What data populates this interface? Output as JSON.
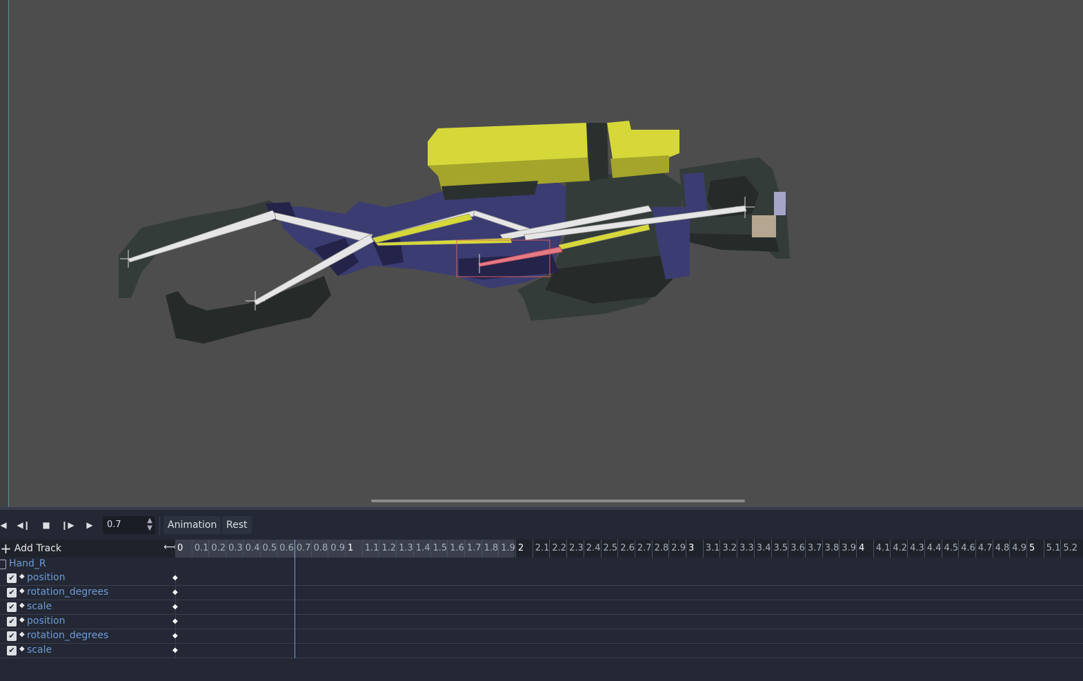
{
  "viewport": {
    "scene_name": "weapon-sprite-with-bone-skeleton"
  },
  "toolbar": {
    "buttons": [
      {
        "name": "play-backwards-from-end",
        "icon": "◀"
      },
      {
        "name": "play-backwards",
        "icon": "◀❙"
      },
      {
        "name": "stop",
        "icon": "■"
      },
      {
        "name": "play-from-start",
        "icon": "❙▶"
      },
      {
        "name": "play",
        "icon": "▶"
      }
    ],
    "time_value": "0.7",
    "spin_icon": "⌃⌄",
    "animation_label": "Animation",
    "rest_label": "Rest"
  },
  "timeline": {
    "add_track_label": "Add Track",
    "add_track_icon": "+",
    "zoom_icon": "⟷",
    "ruler_labels": [
      "0",
      "0.1",
      "0.2",
      "0.3",
      "0.4",
      "0.5",
      "0.6",
      "0.7",
      "0.8",
      "0.9",
      "1",
      "1.1",
      "1.2",
      "1.3",
      "1.4",
      "1.5",
      "1.6",
      "1.7",
      "1.8",
      "1.9",
      "2",
      "2.1",
      "2.2",
      "2.3",
      "2.4",
      "2.5",
      "2.6",
      "2.7",
      "2.8",
      "2.9",
      "3",
      "3.1",
      "3.2",
      "3.3",
      "3.4",
      "3.5",
      "3.6",
      "3.7",
      "3.8",
      "3.9",
      "4",
      "4.1",
      "4.2",
      "4.3",
      "4.4",
      "4.5",
      "4.6",
      "4.7",
      "4.8",
      "4.9",
      "5",
      "5.1",
      "5.2"
    ],
    "current_time": 0.7,
    "playback_range_end": 2.0
  },
  "tracks": {
    "group_name": "Hand_R",
    "items": [
      {
        "label": "position",
        "enabled": true,
        "keyframe": "◆"
      },
      {
        "label": "rotation_degrees",
        "enabled": true,
        "keyframe": "◆"
      },
      {
        "label": "scale",
        "enabled": true,
        "keyframe": "◆"
      },
      {
        "label": "position",
        "enabled": true,
        "keyframe": "◆"
      },
      {
        "label": "rotation_degrees",
        "enabled": true,
        "keyframe": "◆"
      },
      {
        "label": "scale",
        "enabled": true,
        "keyframe": "◆"
      }
    ],
    "check_icon": "✔",
    "dot_icon": "◆"
  },
  "colors": {
    "viewport_bg": "#4d4d4d",
    "panel_bg": "#232834",
    "accent_blue": "#6e9bd8",
    "sprite_yellow": "#d6d83a",
    "sprite_navy": "#3b3c72",
    "sprite_dark": "#2d3431"
  }
}
